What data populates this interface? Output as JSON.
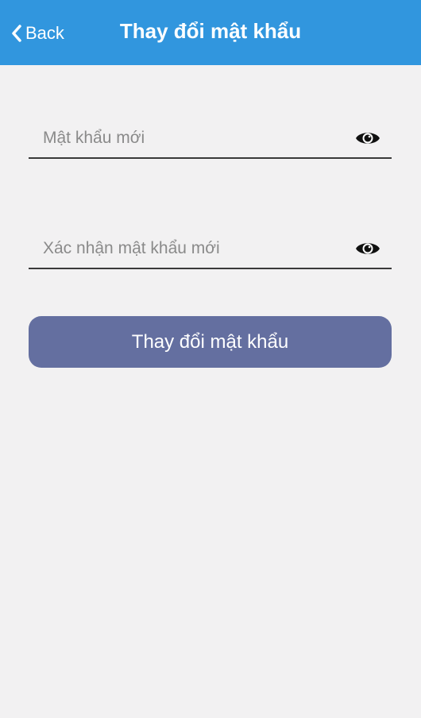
{
  "header": {
    "back_label": "Back",
    "title": "Thay đổi mật khẩu"
  },
  "form": {
    "new_password": {
      "placeholder": "Mật khẩu mới",
      "value": "",
      "toggle_icon": "eye-icon"
    },
    "confirm_password": {
      "placeholder": "Xác nhận mật khẩu mới",
      "value": "",
      "toggle_icon": "eye-icon"
    },
    "submit_label": "Thay đổi mật khẩu"
  },
  "colors": {
    "header_bg": "#3196de",
    "page_bg": "#f2f1f2",
    "button_bg": "#646fa0"
  }
}
